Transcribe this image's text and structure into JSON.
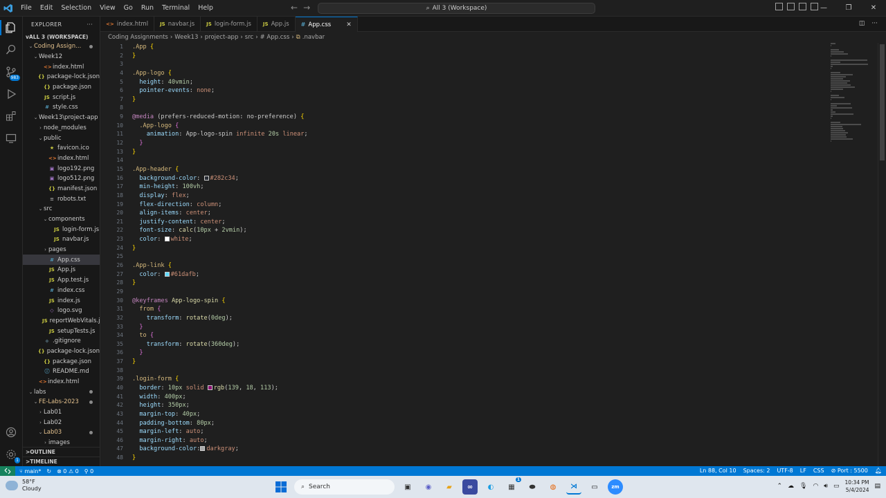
{
  "titlebar": {
    "menu": [
      "File",
      "Edit",
      "Selection",
      "View",
      "Go",
      "Run",
      "Terminal",
      "Help"
    ],
    "command_center": "All 3 (Workspace)"
  },
  "activity": {
    "scm_badge": "983",
    "account_badge": "1"
  },
  "sidebar": {
    "title": "EXPLORER",
    "workspace": "ALL 3 (WORKSPACE)",
    "rows": [
      {
        "depth": 1,
        "chev": "v",
        "label": "Coding Assign...",
        "yellow": true,
        "dot": true
      },
      {
        "depth": 2,
        "chev": "v",
        "label": "Week12"
      },
      {
        "depth": 3,
        "icon": "<>",
        "kind": "html",
        "label": "index.html"
      },
      {
        "depth": 3,
        "icon": "{}",
        "kind": "json",
        "label": "package-lock.json"
      },
      {
        "depth": 3,
        "icon": "{}",
        "kind": "json",
        "label": "package.json"
      },
      {
        "depth": 3,
        "icon": "JS",
        "kind": "js",
        "label": "script.js"
      },
      {
        "depth": 3,
        "icon": "#",
        "kind": "css",
        "label": "style.css"
      },
      {
        "depth": 2,
        "chev": "v",
        "label": "Week13\\project-app"
      },
      {
        "depth": 3,
        "chev": ">",
        "label": "node_modules"
      },
      {
        "depth": 3,
        "chev": "v",
        "label": "public"
      },
      {
        "depth": 4,
        "icon": "★",
        "kind": "ico",
        "label": "favicon.ico"
      },
      {
        "depth": 4,
        "icon": "<>",
        "kind": "html",
        "label": "index.html"
      },
      {
        "depth": 4,
        "icon": "▣",
        "kind": "png",
        "label": "logo192.png"
      },
      {
        "depth": 4,
        "icon": "▣",
        "kind": "png",
        "label": "logo512.png"
      },
      {
        "depth": 4,
        "icon": "{}",
        "kind": "json",
        "label": "manifest.json"
      },
      {
        "depth": 4,
        "icon": "≡",
        "kind": "txt",
        "label": "robots.txt"
      },
      {
        "depth": 3,
        "chev": "v",
        "label": "src"
      },
      {
        "depth": 4,
        "chev": "v",
        "label": "components"
      },
      {
        "depth": 5,
        "icon": "JS",
        "kind": "js",
        "label": "login-form.js"
      },
      {
        "depth": 5,
        "icon": "JS",
        "kind": "js",
        "label": "navbar.js"
      },
      {
        "depth": 4,
        "chev": ">",
        "label": "pages"
      },
      {
        "depth": 4,
        "icon": "#",
        "kind": "css",
        "label": "App.css",
        "selected": true
      },
      {
        "depth": 4,
        "icon": "JS",
        "kind": "js",
        "label": "App.js"
      },
      {
        "depth": 4,
        "icon": "JS",
        "kind": "js",
        "label": "App.test.js"
      },
      {
        "depth": 4,
        "icon": "#",
        "kind": "css",
        "label": "index.css"
      },
      {
        "depth": 4,
        "icon": "JS",
        "kind": "js",
        "label": "index.js"
      },
      {
        "depth": 4,
        "icon": "◇",
        "kind": "svg",
        "label": "logo.svg"
      },
      {
        "depth": 4,
        "icon": "JS",
        "kind": "js",
        "label": "reportWebVitals.js"
      },
      {
        "depth": 4,
        "icon": "JS",
        "kind": "js",
        "label": "setupTests.js"
      },
      {
        "depth": 3,
        "icon": "◆",
        "kind": "git",
        "label": ".gitignore"
      },
      {
        "depth": 3,
        "icon": "{}",
        "kind": "json",
        "label": "package-lock.json"
      },
      {
        "depth": 3,
        "icon": "{}",
        "kind": "json",
        "label": "package.json"
      },
      {
        "depth": 3,
        "icon": "ⓘ",
        "kind": "md",
        "label": "README.md"
      },
      {
        "depth": 2,
        "icon": "<>",
        "kind": "html",
        "label": "index.html"
      },
      {
        "depth": 1,
        "chev": "v",
        "label": "labs",
        "dot": true
      },
      {
        "depth": 2,
        "chev": "v",
        "label": "FE-Labs-2023",
        "yellow": true,
        "dot": true
      },
      {
        "depth": 3,
        "chev": ">",
        "label": "Lab01"
      },
      {
        "depth": 3,
        "chev": ">",
        "label": "Lab02"
      },
      {
        "depth": 3,
        "chev": "v",
        "label": "Lab03",
        "yellow": true,
        "dot": true
      },
      {
        "depth": 4,
        "chev": ">",
        "label": "images"
      }
    ],
    "outline": "OUTLINE",
    "timeline": "TIMELINE"
  },
  "tabs": [
    {
      "icon": "<>",
      "kind": "html",
      "label": "index.html"
    },
    {
      "icon": "JS",
      "kind": "js",
      "label": "navbar.js"
    },
    {
      "icon": "JS",
      "kind": "js",
      "label": "login-form.js"
    },
    {
      "icon": "JS",
      "kind": "js",
      "label": "App.js"
    },
    {
      "icon": "#",
      "kind": "css",
      "label": "App.css",
      "active": true
    }
  ],
  "breadcrumb": [
    "Coding Assignments",
    "Week13",
    "project-app",
    "src",
    "# App.css",
    ".navbar"
  ],
  "code": [
    [
      [
        "t-sel",
        ".App "
      ],
      [
        "t-brace",
        "{"
      ]
    ],
    [
      [
        "t-brace",
        "}"
      ]
    ],
    [],
    [
      [
        "t-sel",
        ".App-logo "
      ],
      [
        "t-brace",
        "{"
      ]
    ],
    [
      [
        "t-plain",
        "  "
      ],
      [
        "t-prop",
        "height"
      ],
      [
        "t-plain",
        ": "
      ],
      [
        "t-num",
        "40vmin"
      ],
      [
        "t-plain",
        ";"
      ]
    ],
    [
      [
        "t-plain",
        "  "
      ],
      [
        "t-prop",
        "pointer-events"
      ],
      [
        "t-plain",
        ": "
      ],
      [
        "t-val",
        "none"
      ],
      [
        "t-plain",
        ";"
      ]
    ],
    [
      [
        "t-brace",
        "}"
      ]
    ],
    [],
    [
      [
        "t-kw",
        "@media"
      ],
      [
        "t-plain",
        " (prefers-reduced-motion: no-preference) "
      ],
      [
        "t-brace",
        "{"
      ]
    ],
    [
      [
        "t-plain",
        "  "
      ],
      [
        "t-sel",
        ".App-logo "
      ],
      [
        "t-brace2",
        "{"
      ]
    ],
    [
      [
        "t-plain",
        "    "
      ],
      [
        "t-prop",
        "animation"
      ],
      [
        "t-plain",
        ": App-logo-spin "
      ],
      [
        "t-val",
        "infinite "
      ],
      [
        "t-num",
        "20s "
      ],
      [
        "t-val",
        "linear"
      ],
      [
        "t-plain",
        ";"
      ]
    ],
    [
      [
        "t-plain",
        "  "
      ],
      [
        "t-brace2",
        "}"
      ]
    ],
    [
      [
        "t-brace",
        "}"
      ]
    ],
    [],
    [
      [
        "t-sel",
        ".App-header "
      ],
      [
        "t-brace",
        "{"
      ]
    ],
    [
      [
        "t-plain",
        "  "
      ],
      [
        "t-prop",
        "background-color"
      ],
      [
        "t-plain",
        ": "
      ],
      [
        "swatch",
        "#282c34"
      ],
      [
        "t-val",
        "#282c34"
      ],
      [
        "t-plain",
        ";"
      ]
    ],
    [
      [
        "t-plain",
        "  "
      ],
      [
        "t-prop",
        "min-height"
      ],
      [
        "t-plain",
        ": "
      ],
      [
        "t-num",
        "100vh"
      ],
      [
        "t-plain",
        ";"
      ]
    ],
    [
      [
        "t-plain",
        "  "
      ],
      [
        "t-prop",
        "display"
      ],
      [
        "t-plain",
        ": "
      ],
      [
        "t-val",
        "flex"
      ],
      [
        "t-plain",
        ";"
      ]
    ],
    [
      [
        "t-plain",
        "  "
      ],
      [
        "t-prop",
        "flex-direction"
      ],
      [
        "t-plain",
        ": "
      ],
      [
        "t-val",
        "column"
      ],
      [
        "t-plain",
        ";"
      ]
    ],
    [
      [
        "t-plain",
        "  "
      ],
      [
        "t-prop",
        "align-items"
      ],
      [
        "t-plain",
        ": "
      ],
      [
        "t-val",
        "center"
      ],
      [
        "t-plain",
        ";"
      ]
    ],
    [
      [
        "t-plain",
        "  "
      ],
      [
        "t-prop",
        "justify-content"
      ],
      [
        "t-plain",
        ": "
      ],
      [
        "t-val",
        "center"
      ],
      [
        "t-plain",
        ";"
      ]
    ],
    [
      [
        "t-plain",
        "  "
      ],
      [
        "t-prop",
        "font-size"
      ],
      [
        "t-plain",
        ": "
      ],
      [
        "t-fn",
        "calc"
      ],
      [
        "t-plain",
        "("
      ],
      [
        "t-num",
        "10px"
      ],
      [
        "t-plain",
        " + "
      ],
      [
        "t-num",
        "2vmin"
      ],
      [
        "t-plain",
        ");"
      ]
    ],
    [
      [
        "t-plain",
        "  "
      ],
      [
        "t-prop",
        "color"
      ],
      [
        "t-plain",
        ": "
      ],
      [
        "swatch",
        "#ffffff"
      ],
      [
        "t-val",
        "white"
      ],
      [
        "t-plain",
        ";"
      ]
    ],
    [
      [
        "t-brace",
        "}"
      ]
    ],
    [],
    [
      [
        "t-sel",
        ".App-link "
      ],
      [
        "t-brace",
        "{"
      ]
    ],
    [
      [
        "t-plain",
        "  "
      ],
      [
        "t-prop",
        "color"
      ],
      [
        "t-plain",
        ": "
      ],
      [
        "swatch",
        "#61dafb"
      ],
      [
        "t-val",
        "#61dafb"
      ],
      [
        "t-plain",
        ";"
      ]
    ],
    [
      [
        "t-brace",
        "}"
      ]
    ],
    [],
    [
      [
        "t-kw",
        "@keyframes"
      ],
      [
        "t-plain",
        " "
      ],
      [
        "t-fn",
        "App-logo-spin"
      ],
      [
        "t-plain",
        " "
      ],
      [
        "t-brace",
        "{"
      ]
    ],
    [
      [
        "t-plain",
        "  "
      ],
      [
        "t-sel",
        "from "
      ],
      [
        "t-brace2",
        "{"
      ]
    ],
    [
      [
        "t-plain",
        "    "
      ],
      [
        "t-prop",
        "transform"
      ],
      [
        "t-plain",
        ": "
      ],
      [
        "t-fn",
        "rotate"
      ],
      [
        "t-plain",
        "("
      ],
      [
        "t-num",
        "0deg"
      ],
      [
        "t-plain",
        ");"
      ]
    ],
    [
      [
        "t-plain",
        "  "
      ],
      [
        "t-brace2",
        "}"
      ]
    ],
    [
      [
        "t-plain",
        "  "
      ],
      [
        "t-sel",
        "to "
      ],
      [
        "t-brace2",
        "{"
      ]
    ],
    [
      [
        "t-plain",
        "    "
      ],
      [
        "t-prop",
        "transform"
      ],
      [
        "t-plain",
        ": "
      ],
      [
        "t-fn",
        "rotate"
      ],
      [
        "t-plain",
        "("
      ],
      [
        "t-num",
        "360deg"
      ],
      [
        "t-plain",
        ");"
      ]
    ],
    [
      [
        "t-plain",
        "  "
      ],
      [
        "t-brace2",
        "}"
      ]
    ],
    [
      [
        "t-brace",
        "}"
      ]
    ],
    [],
    [
      [
        "t-sel",
        ".login-form "
      ],
      [
        "t-brace",
        "{"
      ]
    ],
    [
      [
        "t-plain",
        "  "
      ],
      [
        "t-prop",
        "border"
      ],
      [
        "t-plain",
        ": "
      ],
      [
        "t-num",
        "10px"
      ],
      [
        "t-plain",
        " "
      ],
      [
        "t-val",
        "solid "
      ],
      [
        "swatch",
        "#8b1271"
      ],
      [
        "t-fn",
        "rgb"
      ],
      [
        "t-plain",
        "("
      ],
      [
        "t-num",
        "139"
      ],
      [
        "t-plain",
        ", "
      ],
      [
        "t-num",
        "18"
      ],
      [
        "t-plain",
        ", "
      ],
      [
        "t-num",
        "113"
      ],
      [
        "t-plain",
        ");"
      ]
    ],
    [
      [
        "t-plain",
        "  "
      ],
      [
        "t-prop",
        "width"
      ],
      [
        "t-plain",
        ": "
      ],
      [
        "t-num",
        "400px"
      ],
      [
        "t-plain",
        ";"
      ]
    ],
    [
      [
        "t-plain",
        "  "
      ],
      [
        "t-prop",
        "height"
      ],
      [
        "t-plain",
        ": "
      ],
      [
        "t-num",
        "350px"
      ],
      [
        "t-plain",
        ";"
      ]
    ],
    [
      [
        "t-plain",
        "  "
      ],
      [
        "t-prop",
        "margin-top"
      ],
      [
        "t-plain",
        ": "
      ],
      [
        "t-num",
        "40px"
      ],
      [
        "t-plain",
        ";"
      ]
    ],
    [
      [
        "t-plain",
        "  "
      ],
      [
        "t-prop",
        "padding-bottom"
      ],
      [
        "t-plain",
        ": "
      ],
      [
        "t-num",
        "80px"
      ],
      [
        "t-plain",
        ";"
      ]
    ],
    [
      [
        "t-plain",
        "  "
      ],
      [
        "t-prop",
        "margin-left"
      ],
      [
        "t-plain",
        ": "
      ],
      [
        "t-val",
        "auto"
      ],
      [
        "t-plain",
        ";"
      ]
    ],
    [
      [
        "t-plain",
        "  "
      ],
      [
        "t-prop",
        "margin-right"
      ],
      [
        "t-plain",
        ": "
      ],
      [
        "t-val",
        "auto"
      ],
      [
        "t-plain",
        ";"
      ]
    ],
    [
      [
        "t-plain",
        "  "
      ],
      [
        "t-prop",
        "background-color"
      ],
      [
        "t-plain",
        ":"
      ],
      [
        "swatch",
        "#a9a9a9"
      ],
      [
        "t-val",
        "darkgray"
      ],
      [
        "t-plain",
        ";"
      ]
    ],
    [
      [
        "t-brace",
        "}"
      ]
    ]
  ],
  "statusbar": {
    "branch": "main*",
    "problems": "⊗ 0 ⚠ 0",
    "ports": "⚲ 0",
    "position": "Ln 88, Col 10",
    "spaces": "Spaces: 2",
    "encoding": "UTF-8",
    "eol": "LF",
    "language": "CSS",
    "port": "⊘ Port : 5500"
  },
  "taskbar": {
    "temp": "58°F",
    "condition": "Cloudy",
    "search": "Search",
    "time": "10:34 PM",
    "date": "5/4/2024",
    "store_badge": "1"
  },
  "colors": {
    "accent": "#0078d4",
    "remote": "#16825d",
    "editor_bg": "#1f1f1f",
    "sidebar_bg": "#181818"
  }
}
